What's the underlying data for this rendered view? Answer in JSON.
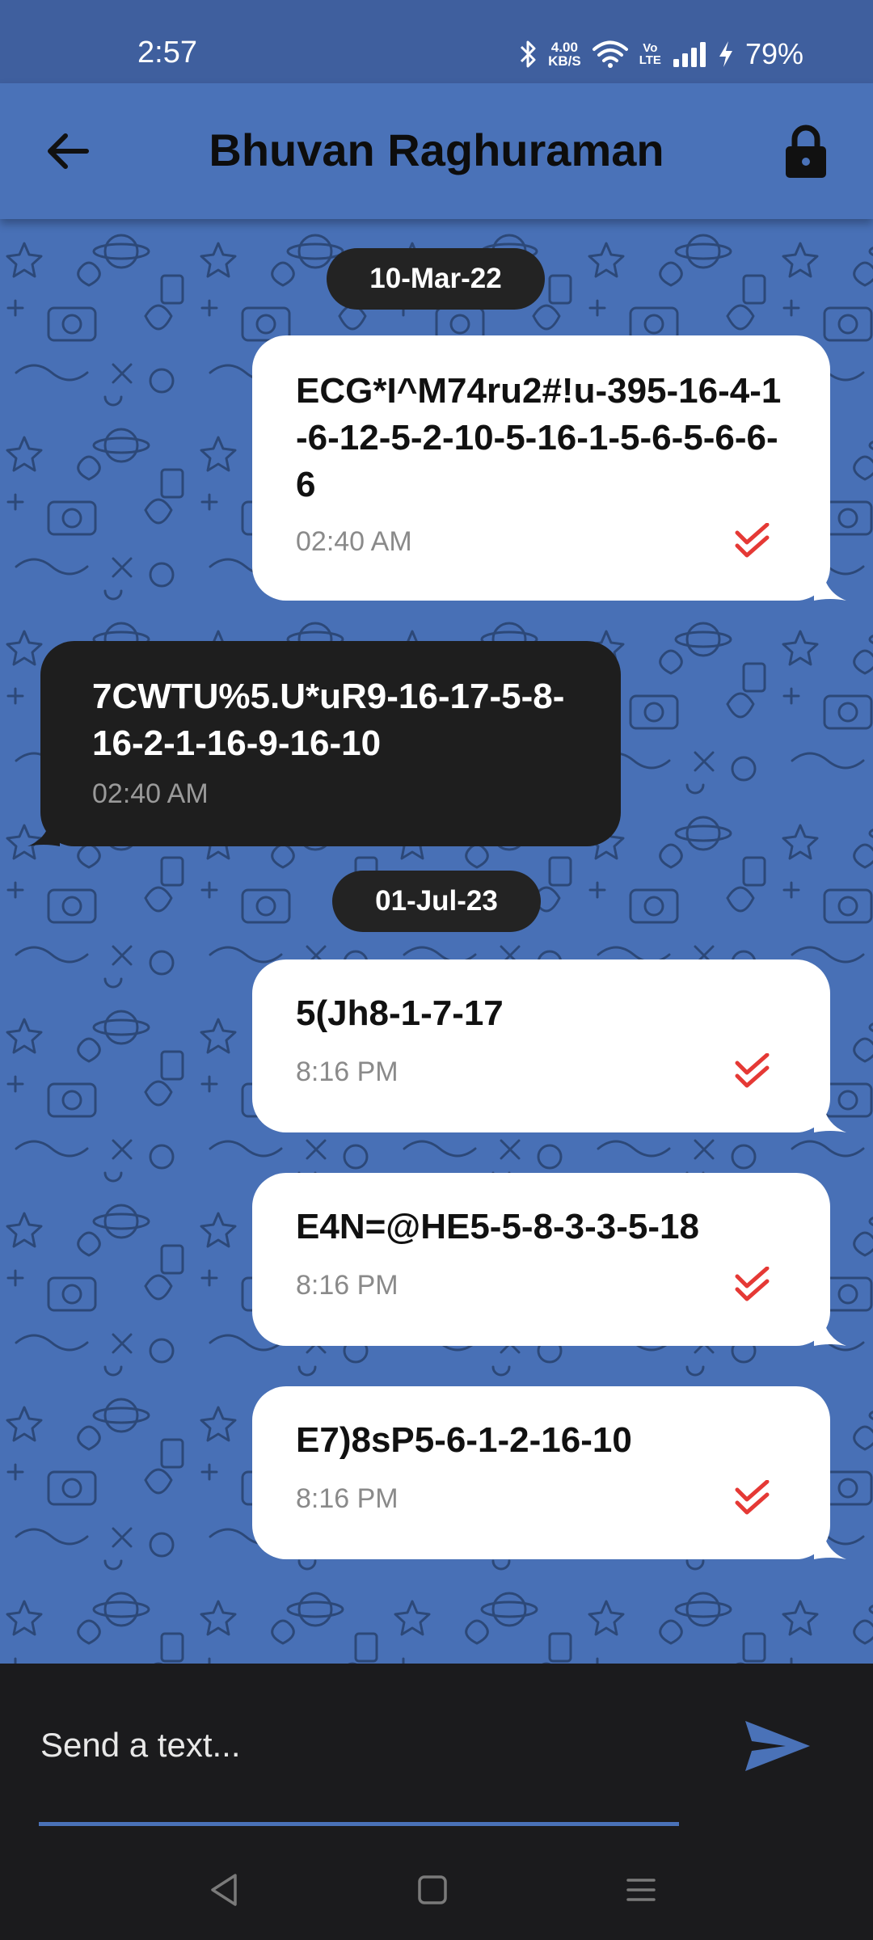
{
  "status_bar": {
    "time": "2:57",
    "net_speed_value": "4.00",
    "net_speed_unit": "KB/S",
    "volte_top": "Vo",
    "volte_bottom": "LTE",
    "battery_percent": "79%",
    "icons": [
      "bluetooth-icon",
      "wifi-icon",
      "signal-icon",
      "charging-icon"
    ]
  },
  "header": {
    "title": "Bhuvan Raghuraman",
    "back_icon": "arrow-left-icon",
    "lock_icon": "lock-icon",
    "background_color": "#4a72b8"
  },
  "chat": {
    "background_color": "#4870b6",
    "groups": [
      {
        "date": "10-Mar-22",
        "messages": [
          {
            "direction": "outgoing",
            "text": "ECG*I^M74ru2#!u-395-16-4-1-6-12-5-2-10-5-16-1-5-6-5-6-6-6",
            "time": "02:40 AM",
            "status": "read"
          },
          {
            "direction": "incoming",
            "text": "7CWTU%5.U*uR9-16-17-5-8-16-2-1-16-9-16-10",
            "time": "02:40 AM"
          }
        ]
      },
      {
        "date": "01-Jul-23",
        "messages": [
          {
            "direction": "outgoing",
            "text": "5(Jh8-1-7-17",
            "time": "8:16 PM",
            "status": "read"
          },
          {
            "direction": "outgoing",
            "text": "E4N=@HE5-5-8-3-3-5-18",
            "time": "8:16 PM",
            "status": "read"
          },
          {
            "direction": "outgoing",
            "text": "E7)8sP5-6-1-2-16-10",
            "time": "8:16 PM",
            "status": "read"
          }
        ]
      }
    ],
    "read_tick_color": "#e53935"
  },
  "composer": {
    "placeholder": "Send a text...",
    "value": "",
    "send_icon": "send-icon",
    "accent_color": "#4a72b8"
  },
  "nav_bar": {
    "icons": [
      "back-triangle-icon",
      "home-square-icon",
      "menu-lines-icon"
    ]
  }
}
